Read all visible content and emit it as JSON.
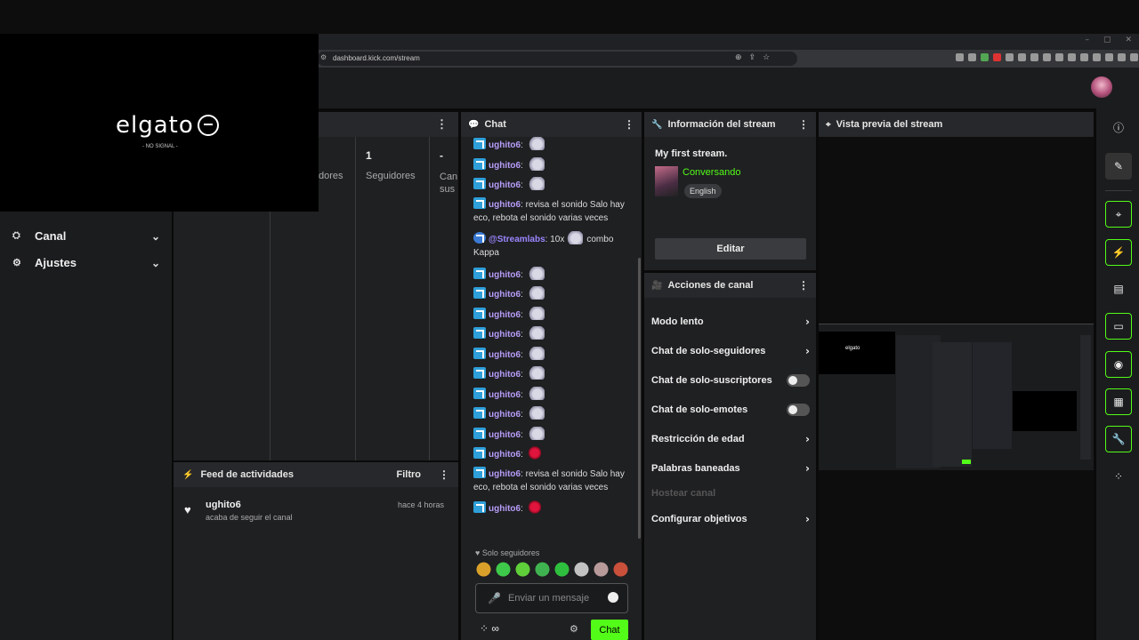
{
  "browser": {
    "url": "dashboard.kick.com/stream",
    "window_controls": [
      "–",
      "▢",
      "✕"
    ]
  },
  "overlay": {
    "brand": "elgato",
    "sub": "- NO SIGNAL -"
  },
  "sidebar": {
    "items": [
      {
        "label": "Canal",
        "icon": "channel-icon"
      },
      {
        "label": "Ajustes",
        "icon": "gear-icon"
      }
    ]
  },
  "stats": {
    "cols": [
      {
        "value": "",
        "label": "dores"
      },
      {
        "value": "1",
        "label": "Seguidores"
      },
      {
        "value": "-",
        "label": "Can sus"
      }
    ]
  },
  "feed": {
    "title": "Feed de actividades",
    "filter": "Filtro",
    "items": [
      {
        "user": "ughito6",
        "action": "acaba de seguir el canal",
        "time": "hace 4 horas"
      }
    ]
  },
  "chat": {
    "title": "Chat",
    "messages": [
      {
        "user": "ughito6",
        "text": "",
        "emote": "rat"
      },
      {
        "user": "ughito6",
        "text": "",
        "emote": "rat"
      },
      {
        "user": "ughito6",
        "text": "",
        "emote": "rat"
      },
      {
        "user": "ughito6",
        "text": "revisa el sonido Salo hay eco, rebota el sonido varias veces",
        "emote": ""
      },
      {
        "user": "@Streamlabs",
        "text": "10x",
        "emote": "rat",
        "suffix": "combo Kappa",
        "bot": true
      },
      {
        "user": "ughito6",
        "text": "",
        "emote": "rat"
      },
      {
        "user": "ughito6",
        "text": "",
        "emote": "rat"
      },
      {
        "user": "ughito6",
        "text": "",
        "emote": "rat"
      },
      {
        "user": "ughito6",
        "text": "",
        "emote": "rat"
      },
      {
        "user": "ughito6",
        "text": "",
        "emote": "rat"
      },
      {
        "user": "ughito6",
        "text": "",
        "emote": "rat"
      },
      {
        "user": "ughito6",
        "text": "",
        "emote": "rat"
      },
      {
        "user": "ughito6",
        "text": "",
        "emote": "rat"
      },
      {
        "user": "ughito6",
        "text": "",
        "emote": "rat"
      },
      {
        "user": "ughito6",
        "text": "",
        "emote": "red"
      },
      {
        "user": "ughito6",
        "text": "revisa el sonido Salo hay eco, rebota el sonido varias veces",
        "emote": ""
      },
      {
        "user": "ughito6",
        "text": "",
        "emote": "red"
      }
    ],
    "followers_only": "Solo seguidores",
    "input_placeholder": "Enviar un mensaje",
    "send_label": "Chat",
    "emote_colors": [
      "#d9a02a",
      "#3ec94a",
      "#5fcf3a",
      "#3fb34f",
      "#2fbf3e",
      "#c2c2c2",
      "#b89a9a",
      "#c9503a"
    ]
  },
  "stream_info": {
    "header": "Información del stream",
    "title": "My first stream.",
    "category": "Conversando",
    "language": "English",
    "edit": "Editar"
  },
  "channel_actions": {
    "header": "Acciones de canal",
    "items": [
      {
        "label": "Modo lento",
        "kind": "chevron"
      },
      {
        "label": "Chat de solo-seguidores",
        "kind": "chevron"
      },
      {
        "label": "Chat de solo-suscriptores",
        "kind": "toggle",
        "on": false
      },
      {
        "label": "Chat de solo-emotes",
        "kind": "toggle",
        "on": false
      },
      {
        "label": "Restricción de edad",
        "kind": "chevron"
      },
      {
        "label": "Palabras baneadas",
        "kind": "chevron"
      },
      {
        "label": "Hostear canal",
        "kind": "disabled"
      },
      {
        "label": "Configurar objetivos",
        "kind": "chevron"
      }
    ]
  },
  "preview": {
    "header": "Vista previa del stream",
    "mini_brand": "elgato"
  },
  "rail": {
    "icons": [
      "info-icon",
      "pencil-icon",
      "camera-icon",
      "lightning-icon",
      "notes-icon",
      "chat-bubble-icon",
      "broadcast-icon",
      "layout-icon",
      "wrench-icon",
      "apps-icon"
    ]
  },
  "colors": {
    "accent": "#53fc18",
    "username": "#b79cf8",
    "badge": "#2e9fd9"
  }
}
